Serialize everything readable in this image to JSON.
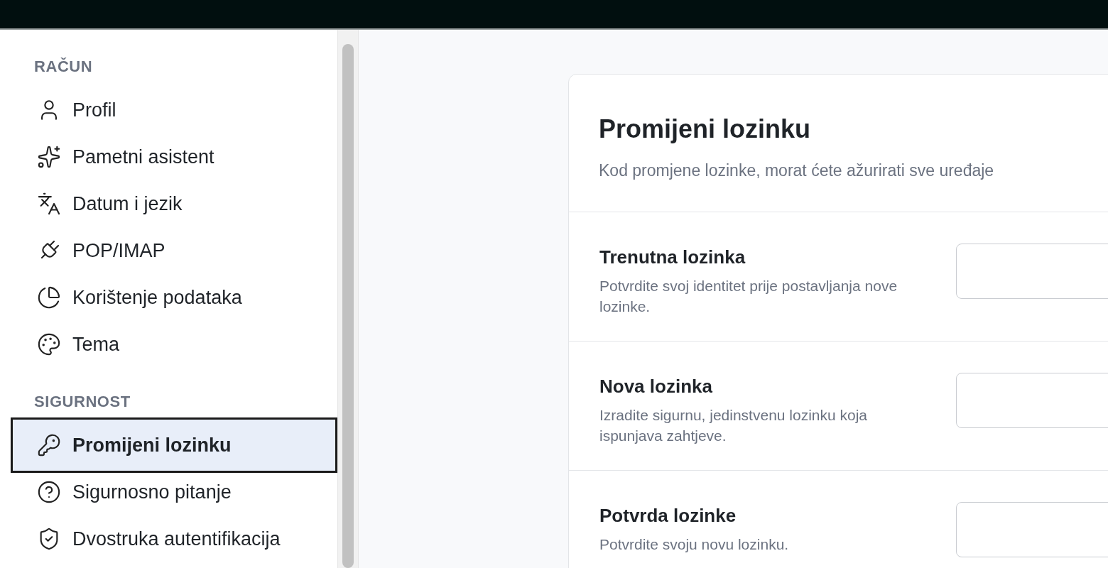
{
  "sidebar": {
    "sections": [
      {
        "heading": "RAČUN",
        "items": [
          {
            "label": "Profil",
            "selected": false
          },
          {
            "label": "Pametni asistent",
            "selected": false
          },
          {
            "label": "Datum i jezik",
            "selected": false
          },
          {
            "label": "POP/IMAP",
            "selected": false
          },
          {
            "label": "Korištenje podataka",
            "selected": false
          },
          {
            "label": "Tema",
            "selected": false
          }
        ]
      },
      {
        "heading": "SIGURNOST",
        "items": [
          {
            "label": "Promijeni lozinku",
            "selected": true
          },
          {
            "label": "Sigurnosno pitanje",
            "selected": false
          },
          {
            "label": "Dvostruka autentifikacija",
            "selected": false
          }
        ]
      }
    ]
  },
  "card": {
    "title": "Promijeni lozinku",
    "subtitle": "Kod promjene lozinke, morat ćete ažurirati sve uređaje",
    "fields": [
      {
        "label": "Trenutna lozinka",
        "description": "Potvrdite svoj identitet prije postavljanja nove lozinke."
      },
      {
        "label": "Nova lozinka",
        "description": "Izradite sigurnu, jedinstvenu lozinku koja ispunjava zahtjeve."
      },
      {
        "label": "Potvrda lozinke",
        "description": "Potvrdite svoju novu lozinku."
      }
    ]
  }
}
